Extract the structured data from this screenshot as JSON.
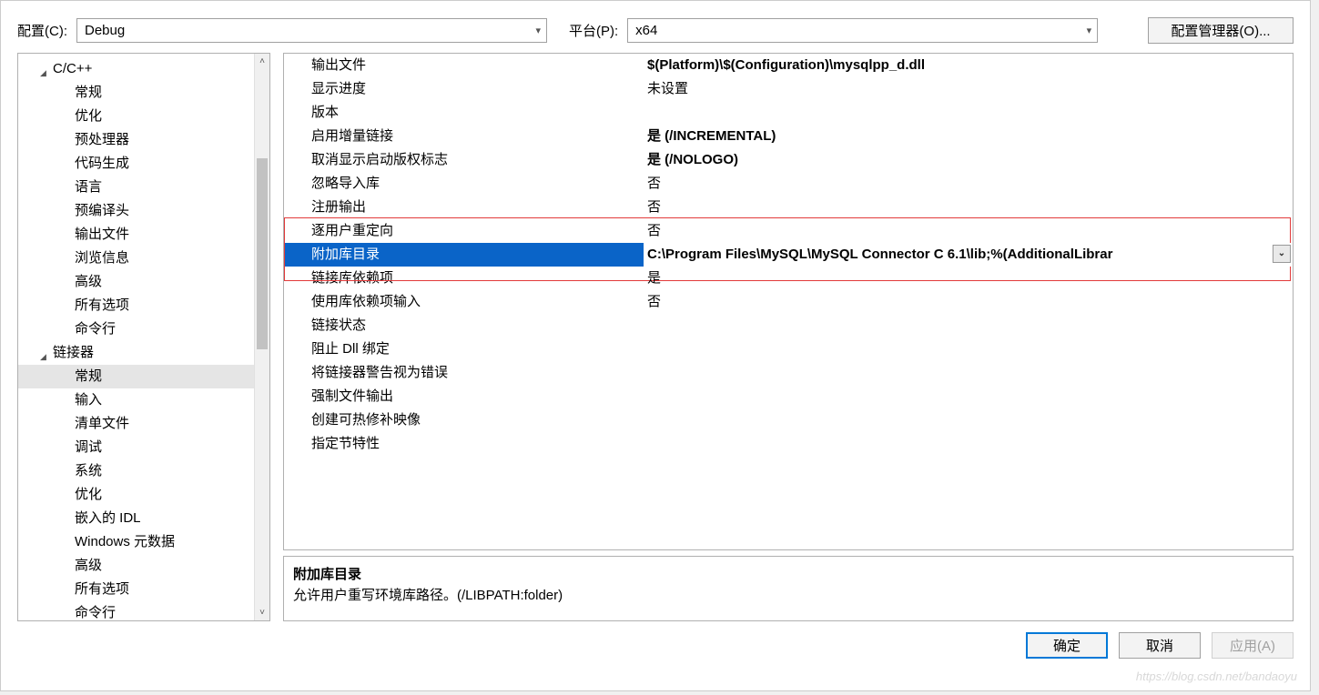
{
  "topbar": {
    "config_label": "配置(C):",
    "config_value": "Debug",
    "platform_label": "平台(P):",
    "platform_value": "x64",
    "config_mgr_btn": "配置管理器(O)..."
  },
  "tree": {
    "groups": [
      {
        "label": "C/C++",
        "items": [
          "常规",
          "优化",
          "预处理器",
          "代码生成",
          "语言",
          "预编译头",
          "输出文件",
          "浏览信息",
          "高级",
          "所有选项",
          "命令行"
        ]
      },
      {
        "label": "链接器",
        "items": [
          "常规",
          "输入",
          "清单文件",
          "调试",
          "系统",
          "优化",
          "嵌入的 IDL",
          "Windows 元数据",
          "高级",
          "所有选项",
          "命令行"
        ],
        "selected": "常规"
      }
    ]
  },
  "grid": [
    {
      "label": "输出文件",
      "value": "$(Platform)\\$(Configuration)\\mysqlpp_d.dll",
      "bold": true
    },
    {
      "label": "显示进度",
      "value": "未设置"
    },
    {
      "label": "版本",
      "value": ""
    },
    {
      "label": "启用增量链接",
      "value": "是 (/INCREMENTAL)",
      "bold": true
    },
    {
      "label": "取消显示启动版权标志",
      "value": "是 (/NOLOGO)",
      "bold": true
    },
    {
      "label": "忽略导入库",
      "value": "否"
    },
    {
      "label": "注册输出",
      "value": "否"
    },
    {
      "label": "逐用户重定向",
      "value": "否"
    },
    {
      "label": "附加库目录",
      "value": "C:\\Program Files\\MySQL\\MySQL Connector C 6.1\\lib;%(AdditionalLibrar",
      "selected": true
    },
    {
      "label": "链接库依赖项",
      "value": "是"
    },
    {
      "label": "使用库依赖项输入",
      "value": "否"
    },
    {
      "label": "链接状态",
      "value": ""
    },
    {
      "label": "阻止 Dll 绑定",
      "value": ""
    },
    {
      "label": "将链接器警告视为错误",
      "value": ""
    },
    {
      "label": "强制文件输出",
      "value": ""
    },
    {
      "label": "创建可热修补映像",
      "value": ""
    },
    {
      "label": "指定节特性",
      "value": ""
    }
  ],
  "desc": {
    "title": "附加库目录",
    "text": "允许用户重写环境库路径。(/LIBPATH:folder)"
  },
  "footer": {
    "ok": "确定",
    "cancel": "取消",
    "apply": "应用(A)"
  },
  "watermark": "https://blog.csdn.net/bandaoyu"
}
